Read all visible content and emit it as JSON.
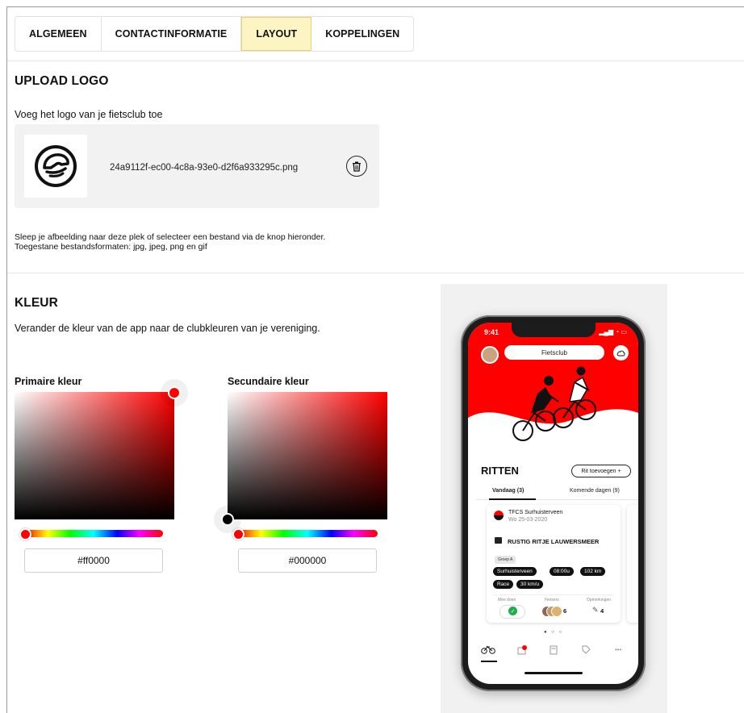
{
  "tabs": [
    {
      "label": "ALGEMEEN",
      "active": false
    },
    {
      "label": "CONTACTINFORMATIE",
      "active": false
    },
    {
      "label": "LAYOUT",
      "active": true
    },
    {
      "label": "KOPPELINGEN",
      "active": false
    }
  ],
  "upload_logo": {
    "title": "UPLOAD LOGO",
    "description": "Voeg het logo van je fietsclub toe",
    "filename": "24a9112f-ec00-4c8a-93e0-d2f6a933295c.png",
    "delete_icon": "trash-icon",
    "help_line1": "Sleep je afbeelding naar deze plek of selecteer een bestand via de knop hieronder.",
    "help_line2": "Toegestane bestandsformaten: jpg, jpeg, png en gif"
  },
  "kleur": {
    "title": "KLEUR",
    "description": "Verander de kleur van de app naar de clubkleuren van je vereniging.",
    "primary": {
      "label": "Primaire kleur",
      "hex": "#ff0000"
    },
    "secondary": {
      "label": "Secundaire kleur",
      "hex": "#000000"
    }
  },
  "preview": {
    "status_time": "9:41",
    "club_name": "Fietsclub",
    "section_title": "RITTEN",
    "add_ride_label": "Rit toevoegen +",
    "segments": [
      "Vandaag (3)",
      "Komende dagen (9)"
    ],
    "card": {
      "club": "TFCS Surhuisterveen",
      "date": "Wo 25-03-2020",
      "ride_title": "RUSTIG RITJE LAUWERSMEER",
      "group": "Groep A",
      "chips": [
        "Surhuisterveen",
        "08:00u",
        "102 km",
        "Race",
        "30 km/u"
      ],
      "stat_labels": [
        "Mee doen",
        "Fietsers",
        "Opmerkingen"
      ],
      "participants": "6",
      "comments": "4"
    },
    "pager": "● ○ ○",
    "tabbar_icons": [
      "bike-icon",
      "calendar-badge-icon",
      "calculator-icon",
      "tag-icon",
      "more-icon"
    ]
  },
  "colors": {
    "accent_tab": "#fdf4c4",
    "app_primary": "#ff0000",
    "app_secondary": "#000000",
    "check_green": "#1fae4e"
  }
}
